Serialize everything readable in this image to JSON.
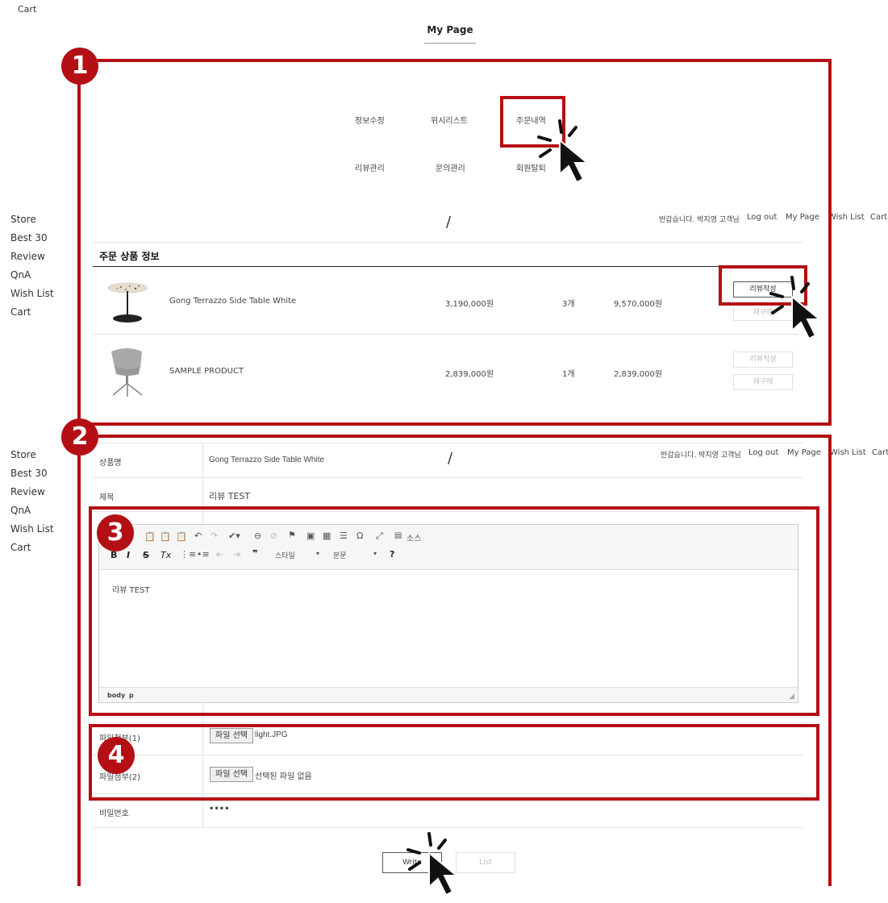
{
  "top_nav": {
    "cart": "Cart",
    "page_title": "My Page"
  },
  "mypage_menu": [
    "정보수정",
    "위시리스트",
    "주문내역",
    "리뷰관리",
    "문의관리",
    "회원탈퇴"
  ],
  "sidebar": [
    "Store",
    "Best 30",
    "Review",
    "QnA",
    "Wish List",
    "Cart"
  ],
  "header": {
    "logo": "/",
    "greeting": "반갑습니다. 박지영 고객님",
    "links": [
      "Log out",
      "My Page",
      "Wish List",
      "Cart"
    ]
  },
  "order": {
    "heading": "주문 상품 정보",
    "rows": [
      {
        "name": "Gong Terrazzo Side Table White",
        "price": "3,190,000원",
        "qty": "3개",
        "total": "9,570,000원",
        "btn_review": "리뷰작성",
        "btn_reorder": "재구매"
      },
      {
        "name": "SAMPLE PRODUCT",
        "price": "2,839,000원",
        "qty": "1개",
        "total": "2,839,000원",
        "btn_review": "리뷰작성",
        "btn_reorder": "재구매"
      }
    ]
  },
  "review_form": {
    "product_label": "상품명",
    "product_value": "Gong Terrazzo Side Table White",
    "title_label": "제목",
    "title_value": "리뷰 TEST",
    "editor": {
      "source_label": "소스",
      "style_label": "스타일",
      "format_label": "본문",
      "content": "리뷰 TEST",
      "path": [
        "body",
        "p"
      ]
    },
    "file1_label": "파일첨부(1)",
    "file1_button": "파일 선택",
    "file1_value": "light.JPG",
    "file2_label": "파일첨부(2)",
    "file2_button": "파일 선택",
    "file2_value": "선택된 파일 없음",
    "password_label": "비밀번호",
    "password_value": "••••",
    "write_button": "Write",
    "list_button": "List"
  },
  "annotations": [
    "1",
    "2",
    "3",
    "4"
  ],
  "colors": {
    "annotation_red": "#b40f14"
  }
}
